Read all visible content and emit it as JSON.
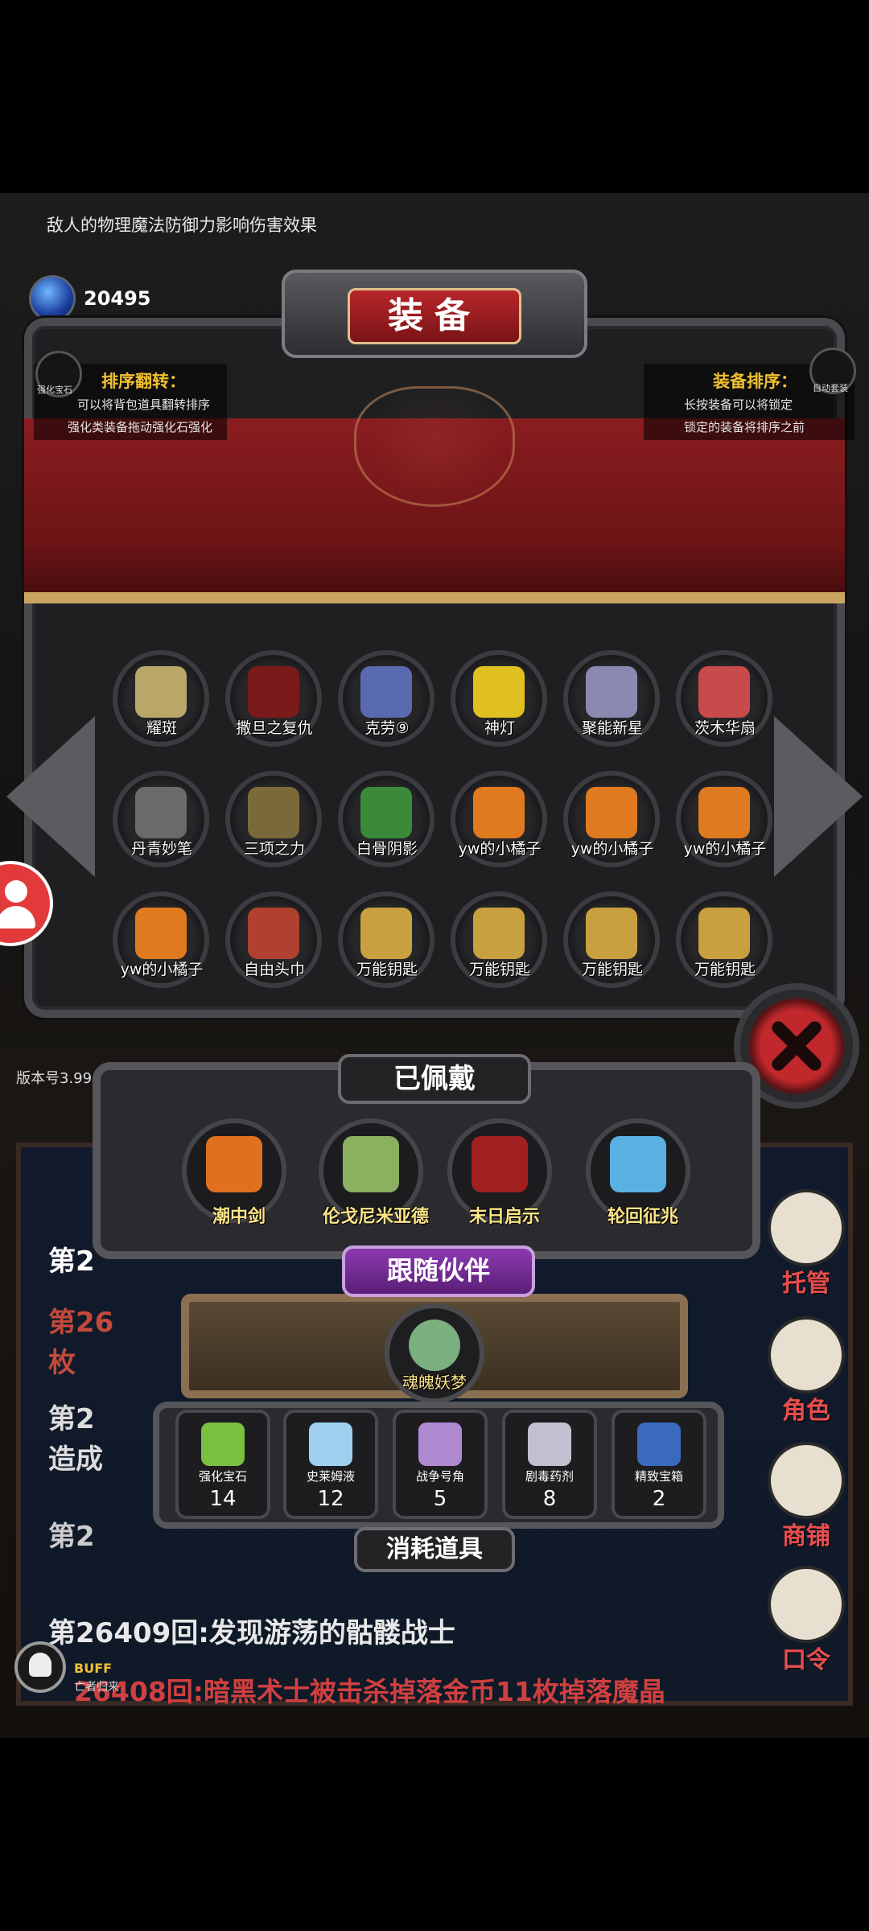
{
  "tip_text": "敌人的物理魔法防御力影响伤害效果",
  "gem_count": "20495",
  "gem_label": "宝石",
  "panel_title": "装备",
  "left_tip": {
    "icon_label": "强化宝石",
    "title": "排序翻转：",
    "line1": "可以将背包道具翻转排序",
    "line2": "强化类装备拖动强化石强化"
  },
  "right_tip": {
    "title": "装备排序：",
    "line1": "长按装备可以将锁定",
    "line2": "锁定的装备将排序之前",
    "icon_label": "自动套装"
  },
  "inventory": [
    {
      "label": "耀斑",
      "color": "#b9a76a"
    },
    {
      "label": "撒旦之复仇",
      "color": "#7a1a1a"
    },
    {
      "label": "克劳⑨",
      "color": "#5a6ab0"
    },
    {
      "label": "神灯",
      "color": "#e0c020"
    },
    {
      "label": "聚能新星",
      "color": "#8a8ab0"
    },
    {
      "label": "茨木华扇",
      "color": "#c94a4a"
    },
    {
      "label": "丹青妙笔",
      "color": "#6a6a6a"
    },
    {
      "label": "三项之力",
      "color": "#7a6a3a"
    },
    {
      "label": "白骨阴影",
      "color": "#3a8a3a"
    },
    {
      "label": "yw的小橘子",
      "color": "#e07a20"
    },
    {
      "label": "yw的小橘子",
      "color": "#e07a20"
    },
    {
      "label": "yw的小橘子",
      "color": "#e07a20"
    },
    {
      "label": "yw的小橘子",
      "color": "#e07a20"
    },
    {
      "label": "自由头巾",
      "color": "#b04030"
    },
    {
      "label": "万能钥匙",
      "color": "#c9a040"
    },
    {
      "label": "万能钥匙",
      "color": "#c9a040"
    },
    {
      "label": "万能钥匙",
      "color": "#c9a040"
    },
    {
      "label": "万能钥匙",
      "color": "#c9a040"
    }
  ],
  "version_text": "版本号3.99",
  "worn_title": "已佩戴",
  "worn_items": [
    {
      "label": "潮中剑",
      "color": "#e07020"
    },
    {
      "label": "伦戈尼米亚德",
      "color": "#8ab060"
    },
    {
      "label": "末日启示",
      "color": "#a02020"
    },
    {
      "label": "轮回征兆",
      "color": "#5ab0e0"
    }
  ],
  "companion_title": "跟随伙伴",
  "companion_name": "魂魄妖梦",
  "consumables_title": "消耗道具",
  "consumables": [
    {
      "label": "强化宝石",
      "count": "14",
      "color": "#7ac040"
    },
    {
      "label": "史莱姆液",
      "count": "12",
      "color": "#a0d0f0"
    },
    {
      "label": "战争号角",
      "count": "5",
      "color": "#b08ad0"
    },
    {
      "label": "剧毒药剂",
      "count": "8",
      "color": "#c0c0d0"
    },
    {
      "label": "精致宝箱",
      "count": "2",
      "color": "#3a6ac0"
    }
  ],
  "side_menu": [
    {
      "label": "托管"
    },
    {
      "label": "角色"
    },
    {
      "label": "商铺"
    },
    {
      "label": "口令"
    }
  ],
  "log": {
    "partial1": "第2",
    "partial2a": "第26",
    "partial2b": "枚",
    "partial3a": "第2",
    "partial3b": "造成",
    "partial4": "第2",
    "line_a": "第26409回:发现游荡的骷髅战士",
    "line_b": "26408回:暗黑术士被击杀掉落金币11枚掉落魔晶"
  },
  "buff_label": "BUFF",
  "buff_sub": "亡者归来"
}
